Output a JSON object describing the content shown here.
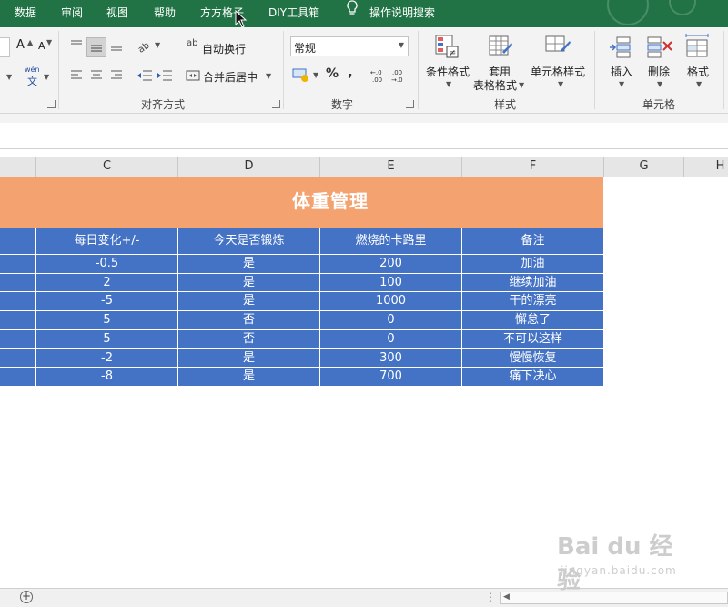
{
  "ribbon_tabs": [
    "数据",
    "审阅",
    "视图",
    "帮助",
    "方方格子",
    "DIY工具箱",
    "操作说明搜索"
  ],
  "ribbon": {
    "font_group": {
      "grow_font": "A",
      "shrink_font": "A",
      "phonetic": "wén",
      "phonetic_sub": "文"
    },
    "alignment": {
      "wrap_text": "自动换行",
      "merge_center": "合并后居中",
      "group_label": "对齐方式",
      "wrap_glyph": "ab"
    },
    "number": {
      "format_value": "常规",
      "percent": "%",
      "comma": ",",
      "increase_decimal": ".0 .00",
      "decrease_decimal": ".00 .0",
      "group_label": "数字"
    },
    "styles": {
      "conditional_formatting": "条件格式",
      "format_as_table_line1": "套用",
      "format_as_table_line2": "表格格式",
      "cell_styles": "单元格样式",
      "group_label": "样式"
    },
    "cells": {
      "insert": "插入",
      "delete": "删除",
      "format": "格式",
      "group_label": "单元格"
    }
  },
  "columns": [
    "C",
    "D",
    "E",
    "F",
    "G",
    "H"
  ],
  "sheet": {
    "title": "体重管理",
    "headers": [
      "每日变化+/-",
      "今天是否锻炼",
      "燃烧的卡路里",
      "备注"
    ],
    "rows": [
      [
        "-0.5",
        "是",
        "200",
        "加油"
      ],
      [
        "2",
        "是",
        "100",
        "继续加油"
      ],
      [
        "-5",
        "是",
        "1000",
        "干的漂亮"
      ],
      [
        "5",
        "否",
        "0",
        "懈怠了"
      ],
      [
        "5",
        "否",
        "0",
        "不可以这样"
      ],
      [
        "-2",
        "是",
        "300",
        "慢慢恢复"
      ],
      [
        "-8",
        "是",
        "700",
        "痛下决心"
      ]
    ]
  },
  "colors": {
    "ribbon_green": "#217346",
    "title_fill": "#f4a26f",
    "table_fill": "#4472c4"
  },
  "bottom": {
    "add_sheet": "+",
    "scroll_dots": "⋮"
  },
  "watermark": {
    "brand": "Bai du 经验",
    "url": "jingyan.baidu.com"
  }
}
